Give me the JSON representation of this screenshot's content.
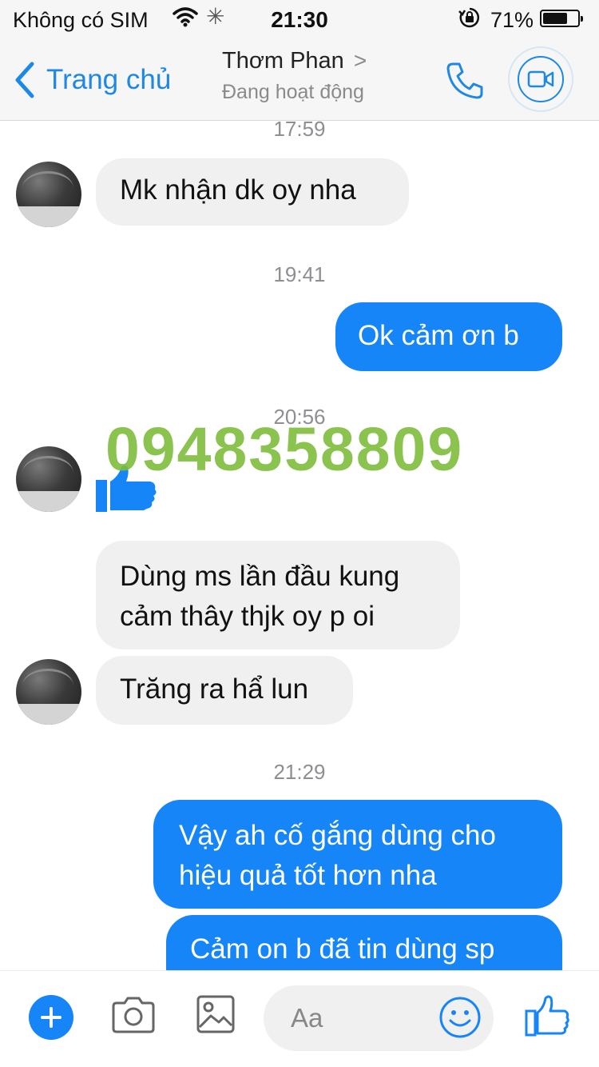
{
  "status_bar": {
    "carrier": "Không có SIM",
    "time": "21:30",
    "battery": "71%",
    "battery_level": 0.71
  },
  "nav": {
    "back_label": "Trang chủ",
    "contact_name": "Thơm Phan",
    "contact_chevron": ">",
    "contact_status": "Đang hoạt động"
  },
  "messages": {
    "ts1": "17:59",
    "m1": "Mk nhận dk oy nha",
    "ts2": "19:41",
    "m2": "Ok cảm ơn b",
    "ts3": "20:56",
    "m4_line1": "Dùng ms lần đầu kung",
    "m4_line2": "cảm thây thjk oy p oi",
    "m5": "Trăng ra hẩ lun",
    "ts4": "21:29",
    "m6_line1": "Vậy ah cố gắng dùng cho",
    "m6_line2": "hiệu quả tốt hơn nha",
    "m7": "Cảm on b đã tin dùng sp"
  },
  "watermark": "0948358809",
  "composer": {
    "placeholder": "Aa"
  },
  "colors": {
    "accent": "#1e88e5",
    "outgoing_bubble": "#1685f8",
    "incoming_bubble": "#f1f0f0",
    "watermark": "#7fbd3c"
  },
  "icons": {
    "wifi": "wifi-icon",
    "activity": "activity-spinner-icon",
    "orientation_lock": "orientation-lock-icon",
    "back": "chevron-left-icon",
    "call": "phone-icon",
    "video": "video-camera-icon",
    "like": "thumbs-up-icon",
    "plus": "plus-icon",
    "camera": "camera-icon",
    "gallery": "image-icon",
    "emoji": "smiley-icon"
  }
}
